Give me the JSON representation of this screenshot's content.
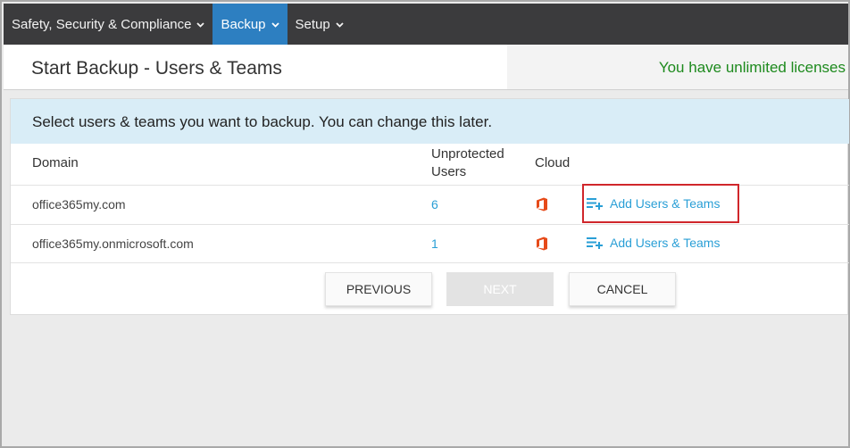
{
  "nav": {
    "items": [
      {
        "label": "Safety, Security & Compliance",
        "active": false
      },
      {
        "label": "Backup",
        "active": true
      },
      {
        "label": "Setup",
        "active": false
      }
    ]
  },
  "header": {
    "title": "Start Backup - Users & Teams",
    "license_text": "You have unlimited licenses"
  },
  "banner": {
    "text": "Select users & teams you want to backup. You can change this later."
  },
  "table": {
    "columns": {
      "domain": "Domain",
      "unprotected_line1": "Unprotected",
      "unprotected_line2": "Users",
      "cloud": "Cloud"
    },
    "rows": [
      {
        "domain": "office365my.com",
        "unprotected": "6",
        "cloud_icon": "office365-icon",
        "action": "Add Users & Teams"
      },
      {
        "domain": "office365my.onmicrosoft.com",
        "unprotected": "1",
        "cloud_icon": "office365-icon",
        "action": "Add Users & Teams"
      }
    ]
  },
  "buttons": {
    "previous": "PREVIOUS",
    "next": "NEXT",
    "cancel": "CANCEL"
  },
  "colors": {
    "nav_bg": "#3b3b3d",
    "nav_active": "#2d7fc1",
    "license_green": "#1d8a1d",
    "banner_bg": "#d9edf7",
    "link_blue": "#2a9fd6",
    "office_orange": "#e64a19",
    "highlight_red": "#d0262b"
  }
}
